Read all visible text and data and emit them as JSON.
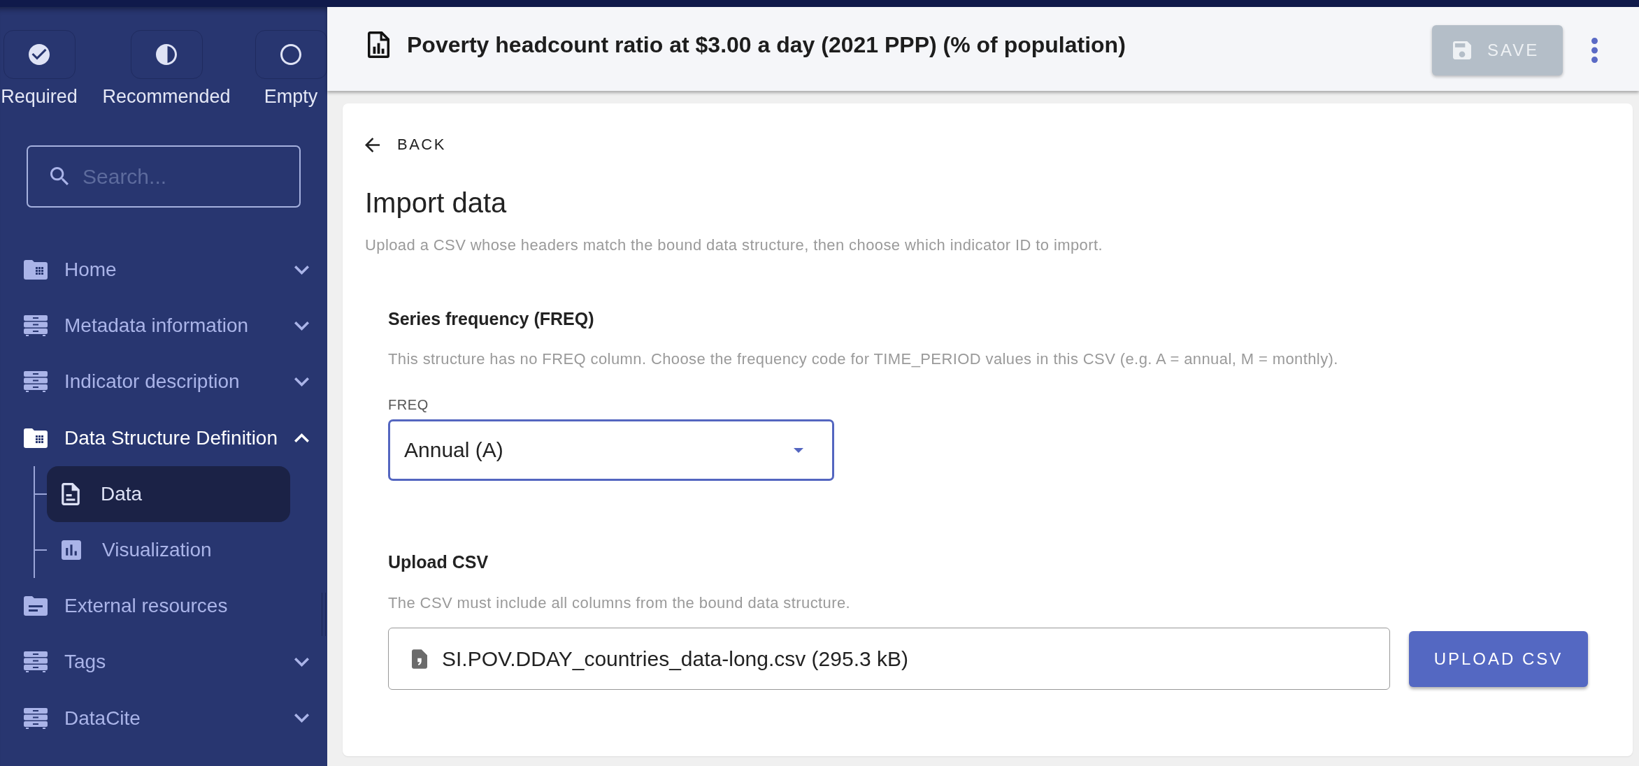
{
  "legend": [
    {
      "kind": "required",
      "label": "Required"
    },
    {
      "kind": "recommended",
      "label": "Recommended"
    },
    {
      "kind": "empty",
      "label": "Empty"
    }
  ],
  "search": {
    "placeholder": "Search..."
  },
  "nav": [
    {
      "kind": "folder",
      "label": "Home",
      "expanded": false
    },
    {
      "kind": "drawers",
      "label": "Metadata information",
      "expanded": false
    },
    {
      "kind": "drawers",
      "label": "Indicator description",
      "expanded": false
    },
    {
      "kind": "folder",
      "label": "Data Structure Definition",
      "expanded": true,
      "children": [
        {
          "kind": "document",
          "label": "Data",
          "selected": true
        },
        {
          "kind": "chart",
          "label": "Visualization",
          "selected": false
        }
      ]
    },
    {
      "kind": "notes-folder",
      "label": "External resources"
    },
    {
      "kind": "drawers",
      "label": "Tags",
      "expanded": false
    },
    {
      "kind": "drawers",
      "label": "DataCite",
      "expanded": false
    }
  ],
  "header": {
    "title": "Poverty headcount ratio at $3.00 a day (2021 PPP) (% of population)",
    "save_button": {
      "label": "SAVE",
      "disabled": true
    }
  },
  "back": {
    "label": "BACK"
  },
  "page": {
    "title": "Import data",
    "description": "Upload a CSV whose headers match the bound data structure, then choose which indicator ID to import."
  },
  "sections": [
    {
      "kind": "select",
      "title": "Series frequency (FREQ)",
      "description": "This structure has no FREQ column. Choose the frequency code for TIME_PERIOD values in this CSV (e.g. A = annual, M = monthly).",
      "field": {
        "label": "FREQ",
        "value": "Annual (A)",
        "focused": true
      }
    },
    {
      "kind": "file",
      "title": "Upload CSV",
      "description": "The CSV must include all columns from the bound data structure.",
      "field": {
        "value": "SI.POV.DDAY_countries_data-long.csv (295.3 kB)",
        "focused": false
      },
      "button": {
        "label": "UPLOAD CSV"
      }
    }
  ]
}
